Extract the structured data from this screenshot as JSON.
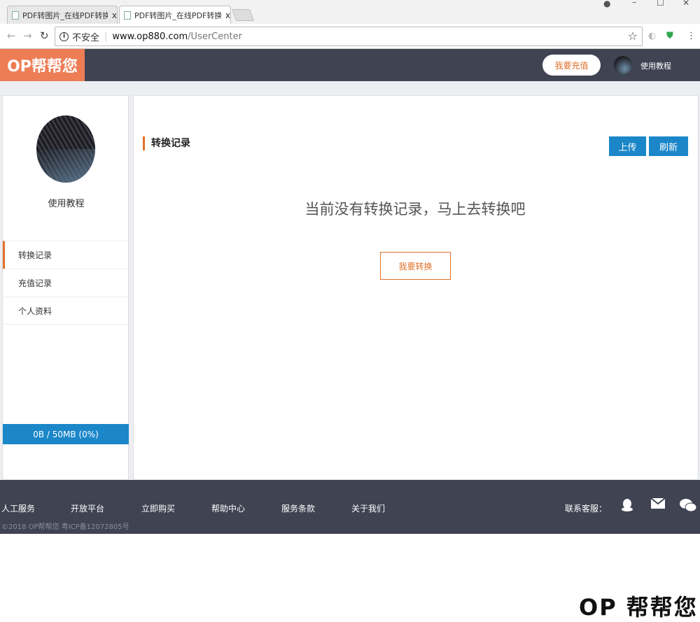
{
  "browser": {
    "tabs": [
      {
        "label": "PDF转图片_在线PDF转换",
        "close": "x",
        "active": false
      },
      {
        "label": "PDF转图片_在线PDF转换",
        "close": "x",
        "active": true
      }
    ],
    "security_text": "不安全",
    "url_host": "www.op880.com",
    "url_path": "/UserCenter"
  },
  "header": {
    "logo": "OP帮帮您",
    "recharge_button": "我要充值",
    "username": "使用教程"
  },
  "sidebar": {
    "username": "使用教程",
    "menu": [
      {
        "label": "转换记录",
        "active": true
      },
      {
        "label": "充值记录",
        "active": false
      },
      {
        "label": "个人资料",
        "active": false
      }
    ],
    "quota_text": "0B / 50MB (0%)",
    "quota_used_fraction": 0.0
  },
  "main": {
    "section_title": "转换记录",
    "upload_button": "上传",
    "refresh_button": "刷新",
    "empty_message": "当前没有转换记录，马上去转换吧",
    "convert_button": "我要转换"
  },
  "footer": {
    "links": [
      "人工服务",
      "开放平台",
      "立即购买",
      "帮助中心",
      "服务条款",
      "关于我们"
    ],
    "contact_label": "联系客服：",
    "copyright": "©2018 OP帮帮您 粤ICP备12072805号"
  },
  "watermark": "OP 帮帮您",
  "colors": {
    "accent_orange": "#e0702a",
    "logo_bg": "#ed7d55",
    "header_bg": "#3f4352",
    "primary_blue": "#1b87c9"
  }
}
